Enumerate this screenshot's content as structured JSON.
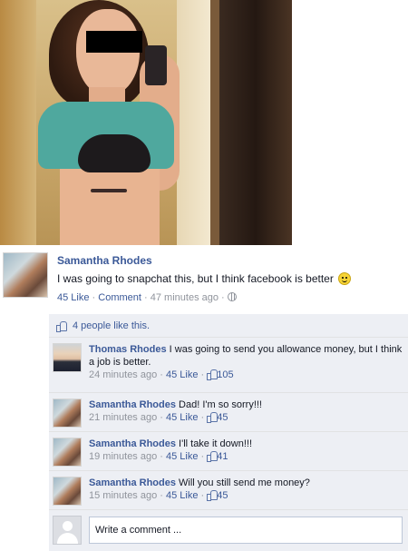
{
  "post": {
    "author": "Samantha Rhodes",
    "status": "I was going to snapchat this, but I think facebook is better",
    "like_label": "45 Like",
    "comment_label": "Comment",
    "time": "47 minutes ago"
  },
  "likes": {
    "summary": "4 people like this."
  },
  "comments": [
    {
      "author": "Thomas Rhodes",
      "text": "I was going to send you allowance money, but I think a job is better.",
      "time": "24 minutes ago",
      "like_label": "45 Like",
      "likes": "105"
    },
    {
      "author": "Samantha Rhodes",
      "text": "Dad! I'm so sorry!!!",
      "time": "21 minutes ago",
      "like_label": "45 Like",
      "likes": "45"
    },
    {
      "author": "Samantha Rhodes",
      "text": "I'll take it down!!!",
      "time": "19 minutes ago",
      "like_label": "45 Like",
      "likes": "41"
    },
    {
      "author": "Samantha Rhodes",
      "text": "Will you still send me money?",
      "time": "15 minutes ago",
      "like_label": "45 Like",
      "likes": "45"
    }
  ],
  "write_comment": {
    "placeholder": "Write a comment ..."
  },
  "colors": {
    "link": "#3b5998",
    "meta": "#90949c",
    "comment_bg": "#edeff4"
  },
  "icons": {
    "smiley": "smiley-icon",
    "globe": "globe-icon",
    "thumb": "thumbs-up-icon"
  }
}
